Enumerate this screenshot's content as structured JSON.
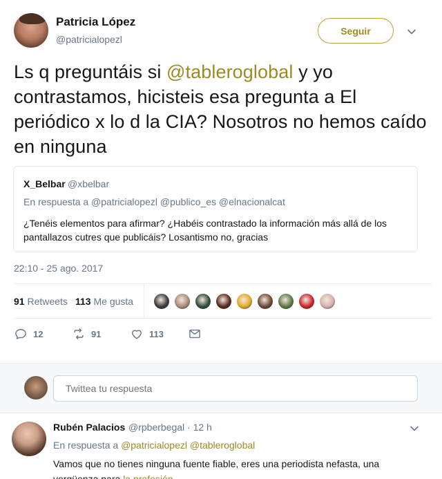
{
  "tweet": {
    "author_name": "Patricia López",
    "author_handle": "@patricialopezl",
    "follow_label": "Seguir",
    "text_part1": "Ls q preguntáis si ",
    "text_mention": "@tableroglobal",
    "text_part2": " y yo contrastamos, hicisteis esa pregunta a El periódico x lo d la CIA? Nosotros no hemos caído en ninguna",
    "timestamp": "22:10 - 25 ago. 2017"
  },
  "quote": {
    "name": "X_Belbar",
    "handle": "@xbelbar",
    "reply_context": "En respuesta a @patricialopezl @publico_es @elnacionalcat",
    "text": "¿Tenéis elementos para afirmar? ¿Habéis contrastado la información más allá de los pantallazos cutres que publicáis? Losantismo no, gracias"
  },
  "stats": {
    "retweets_count": "91",
    "retweets_label": "Retweets",
    "likes_count": "113",
    "likes_label": "Me gusta"
  },
  "likers": [
    {
      "name": "liker-avatar-1",
      "color": "#3c3c3c"
    },
    {
      "name": "liker-avatar-2",
      "color": "#a88b78"
    },
    {
      "name": "liker-avatar-3",
      "color": "#2f4f3a"
    },
    {
      "name": "liker-avatar-4",
      "color": "#5a2a22"
    },
    {
      "name": "liker-avatar-5",
      "color": "#e3a928"
    },
    {
      "name": "liker-avatar-6",
      "color": "#6b4a35"
    },
    {
      "name": "liker-avatar-7",
      "color": "#5c7a48"
    },
    {
      "name": "liker-avatar-8",
      "color": "#c8282a"
    },
    {
      "name": "liker-avatar-9",
      "color": "#d4b2aa"
    }
  ],
  "actions": {
    "reply_count": "12",
    "retweet_count": "91",
    "like_count": "113"
  },
  "reply_box": {
    "placeholder": "Twittea tu respuesta"
  },
  "reply": {
    "name": "Rubén Palacios",
    "handle_time": "@rpberbegal · 12 h",
    "reply_prefix": "En respuesta a ",
    "reply_mentions": "@patricialopezl @tableroglobal",
    "text_part1": "Vamos que no tienes ninguna fuente fiable, eres una periodista nefasta, una vergüenza para ",
    "text_link": "la profesión"
  },
  "colors": {
    "accent": "#9d8a22",
    "muted": "#657786",
    "text": "#14171a",
    "border": "#e6ecf0"
  }
}
